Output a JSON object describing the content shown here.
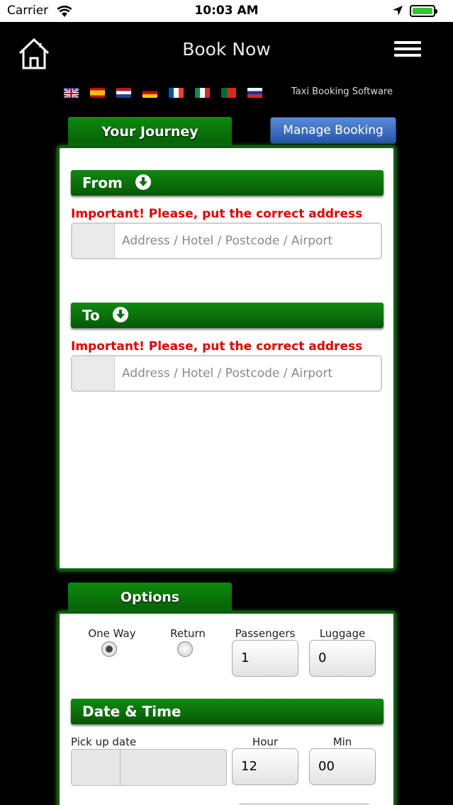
{
  "status": {
    "carrier": "Carrier",
    "time": "10:03 AM"
  },
  "header": {
    "title": "Book Now",
    "subtitle": "Taxi Booking Software"
  },
  "flags": [
    "uk-flag-icon",
    "spain-flag-icon",
    "netherlands-flag-icon",
    "germany-flag-icon",
    "france-flag-icon",
    "italy-flag-icon",
    "portugal-flag-icon",
    "russia-flag-icon"
  ],
  "tabs": {
    "journey": "Your Journey",
    "manage": "Manage Booking",
    "options": "Options"
  },
  "from": {
    "label": "From",
    "warning": "Important! Please, put the correct address",
    "placeholder": "Address / Hotel / Postcode / Airport"
  },
  "to": {
    "label": "To",
    "warning": "Important! Please, put the correct address",
    "placeholder": "Address / Hotel / Postcode / Airport"
  },
  "options": {
    "one_way": "One Way",
    "return": "Return",
    "passengers_label": "Passengers",
    "passengers_value": "1",
    "luggage_label": "Luggage",
    "luggage_value": "0",
    "selected_trip": "One Way"
  },
  "datetime": {
    "title": "Date & Time",
    "pickup_label": "Pick up date",
    "hour_label": "Hour",
    "hour_value": "12",
    "min_label": "Min",
    "min_value": "00"
  },
  "colors": {
    "accent_green": "#0c8a0c",
    "manage_blue": "#3b6fc0",
    "warning_red": "#e00000"
  }
}
